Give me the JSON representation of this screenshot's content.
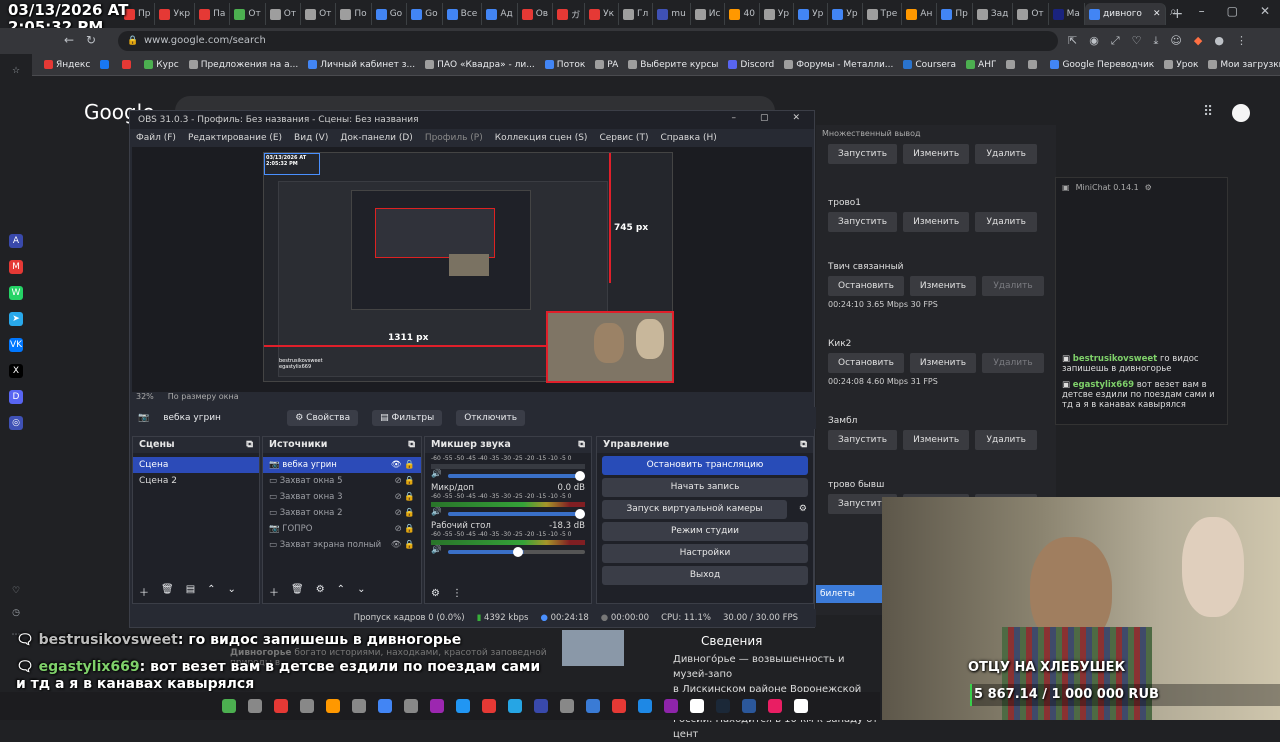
{
  "clock": {
    "line1": "03/13/2026 AT",
    "line2": "2:05:32 PM"
  },
  "tabs": [
    {
      "label": "Пр",
      "color": "#e53935"
    },
    {
      "label": "Укр",
      "color": "#e53935"
    },
    {
      "label": "Па",
      "color": "#e53935"
    },
    {
      "label": "От",
      "color": "#4caf50"
    },
    {
      "label": "От",
      "color": "#9e9e9e"
    },
    {
      "label": "От",
      "color": "#9e9e9e"
    },
    {
      "label": "По",
      "color": "#9e9e9e"
    },
    {
      "label": "Go",
      "color": "#4285f4"
    },
    {
      "label": "Go",
      "color": "#4285f4"
    },
    {
      "label": "Все",
      "color": "#4285f4"
    },
    {
      "label": "Ад",
      "color": "#4285f4"
    },
    {
      "label": "Ов",
      "color": "#e53935"
    },
    {
      "label": "ガ",
      "color": "#e53935"
    },
    {
      "label": "Ук",
      "color": "#e53935"
    },
    {
      "label": "Гл",
      "color": "#9e9e9e"
    },
    {
      "label": "mu",
      "color": "#3f51b5"
    },
    {
      "label": "Ис",
      "color": "#9e9e9e"
    },
    {
      "label": "40",
      "color": "#ff9800"
    },
    {
      "label": "Ур",
      "color": "#9e9e9e"
    },
    {
      "label": "Ур",
      "color": "#4285f4"
    },
    {
      "label": "Ур",
      "color": "#4285f4"
    },
    {
      "label": "Тре",
      "color": "#9e9e9e"
    },
    {
      "label": "Ан",
      "color": "#ff9800"
    },
    {
      "label": "Пр",
      "color": "#4285f4"
    },
    {
      "label": "Зад",
      "color": "#9e9e9e"
    },
    {
      "label": "От",
      "color": "#9e9e9e"
    },
    {
      "label": "Ma",
      "color": "#1a237e"
    },
    {
      "label": "дивного",
      "color": "#4285f4",
      "active": true
    }
  ],
  "omnibox": {
    "url": "www.google.com/search"
  },
  "bookmarks": [
    {
      "label": "Яндекс",
      "color": "#e53935"
    },
    {
      "label": "",
      "color": "#1877f2"
    },
    {
      "label": "",
      "color": "#e53935"
    },
    {
      "label": "Курс",
      "color": "#4caf50"
    },
    {
      "label": "Предложения на а...",
      "color": "#9e9e9e"
    },
    {
      "label": "Личный кабинет з...",
      "color": "#4285f4"
    },
    {
      "label": "ПАО «Квадра» - ли...",
      "color": "#9e9e9e"
    },
    {
      "label": "Поток",
      "color": "#4285f4"
    },
    {
      "label": "PA",
      "color": "#9e9e9e"
    },
    {
      "label": "Выберите курсы",
      "color": "#9e9e9e"
    },
    {
      "label": "Discord",
      "color": "#5865f2"
    },
    {
      "label": "Форумы - Металли...",
      "color": "#9e9e9e"
    },
    {
      "label": "Coursera",
      "color": "#2a73cc"
    },
    {
      "label": "АНГ",
      "color": "#4caf50"
    },
    {
      "label": "",
      "color": "#9e9e9e"
    },
    {
      "label": "",
      "color": "#9e9e9e"
    },
    {
      "label": "Google Переводчик",
      "color": "#4285f4"
    },
    {
      "label": "Урок",
      "color": "#9e9e9e"
    },
    {
      "label": "Мои загрузки на са...",
      "color": "#9e9e9e"
    }
  ],
  "google": {
    "logo": "Google"
  },
  "obs": {
    "title": "OBS 31.0.3 - Профиль: Без названия - Сцены: Без названия",
    "menu": [
      "Файл (F)",
      "Редактирование (E)",
      "Вид (V)",
      "Док-панели (D)",
      "Профиль (P)",
      "Коллекция сцен (S)",
      "Сервис (T)",
      "Справка (H)"
    ],
    "preview": {
      "zoom": "32%",
      "zoom_mode": "По размеру окна",
      "label_745": "745 px",
      "label_1311": "1311 px"
    },
    "source_bar": {
      "source": "вебка угрин",
      "properties": "Свойства",
      "filters": "Фильтры",
      "disable": "Отключить"
    },
    "scenes": {
      "title": "Сцены",
      "items": [
        "Сцена",
        "Сцена 2"
      ]
    },
    "sources": {
      "title": "Источники",
      "items": [
        "вебка угрин",
        "Захват окна 5",
        "Захват окна 3",
        "Захват окна 2",
        "ГОПРО",
        "Захват экрана полный"
      ]
    },
    "mixer": {
      "title": "Микшер звука",
      "ticks": "-60 -55 -50 -45 -40 -35 -30 -25 -20 -15 -10 -5 0",
      "channels": [
        {
          "name": "",
          "db": "",
          "active": false,
          "volume": 1.0
        },
        {
          "name": "Микр/доп",
          "db": "0.0 dB",
          "active": true,
          "volume": 1.0
        },
        {
          "name": "Рабочий стол",
          "db": "-18.3 dB",
          "active": true,
          "volume": 0.55
        }
      ]
    },
    "controls": {
      "title": "Управление",
      "buttons": [
        "Остановить трансляцию",
        "Начать запись",
        "Запуск виртуальной камеры",
        "Режим студии",
        "Настройки",
        "Выход"
      ]
    },
    "status": {
      "dropped": "Пропуск кадров 0 (0.0%)",
      "bitrate": "4392 kbps",
      "live": "00:24:18",
      "rec": "00:00:00",
      "cpu": "CPU: 11.1%",
      "fps": "30.00 / 30.00 FPS"
    }
  },
  "multi_output": {
    "title": "Множественный вывод",
    "buttons": {
      "start": "Запустить",
      "edit": "Изменить",
      "delete": "Удалить",
      "stop": "Остановить"
    },
    "outputs": [
      {
        "name": "",
        "state": "idle",
        "stats": ""
      },
      {
        "name": "трово1",
        "state": "idle",
        "stats": ""
      },
      {
        "name": "Твич связанный",
        "state": "live",
        "stats": "00:24:10  3.65 Mbps  30 FPS"
      },
      {
        "name": "Кик2",
        "state": "live",
        "stats": "00:24:08  4.60 Mbps  31 FPS"
      },
      {
        "name": "Замбл",
        "state": "idle",
        "stats": ""
      },
      {
        "name": "трово бывш",
        "state": "idle",
        "stats": ""
      }
    ],
    "tickets": "билеты"
  },
  "minichat": {
    "title": "MiniChat 0.14.1",
    "messages": [
      {
        "user": "bestrusikovsweet",
        "text": "го видос запишешь в дивногорье"
      },
      {
        "user": "egastylix669",
        "text": "вот везет вам в детсве ездили по поездам сами и тд а я в канавах кавырялся"
      }
    ]
  },
  "overlay_chat": [
    {
      "user": "bestrusikovsweet",
      "text": "го видос запишешь в дивногорье"
    },
    {
      "user": "egastylix669",
      "text": "вот везет вам в детсве ездили по поездам сами и тд а я в канавах кавырялся"
    }
  ],
  "search_result": {
    "line1": "Дивногорье",
    "line2": "богато историями, находками, красотой заповедной природы в"
  },
  "wiki": {
    "title": "Сведения",
    "line1": "Дивного́рье — возвышенность и музей-запо",
    "line2": "в Лискинском районе Воронежской области",
    "line3": "России. Находится в 10 км к западу от цент"
  },
  "webcam": {
    "caption": "ОТЦУ НА ХЛЕБУШЕК",
    "progress_text": "5 867.14 / 1 000 000 RUB",
    "progress": 0.0059
  },
  "colors": {
    "obs_blue": "#2c4bb8",
    "donation_green": "#38d04a"
  }
}
